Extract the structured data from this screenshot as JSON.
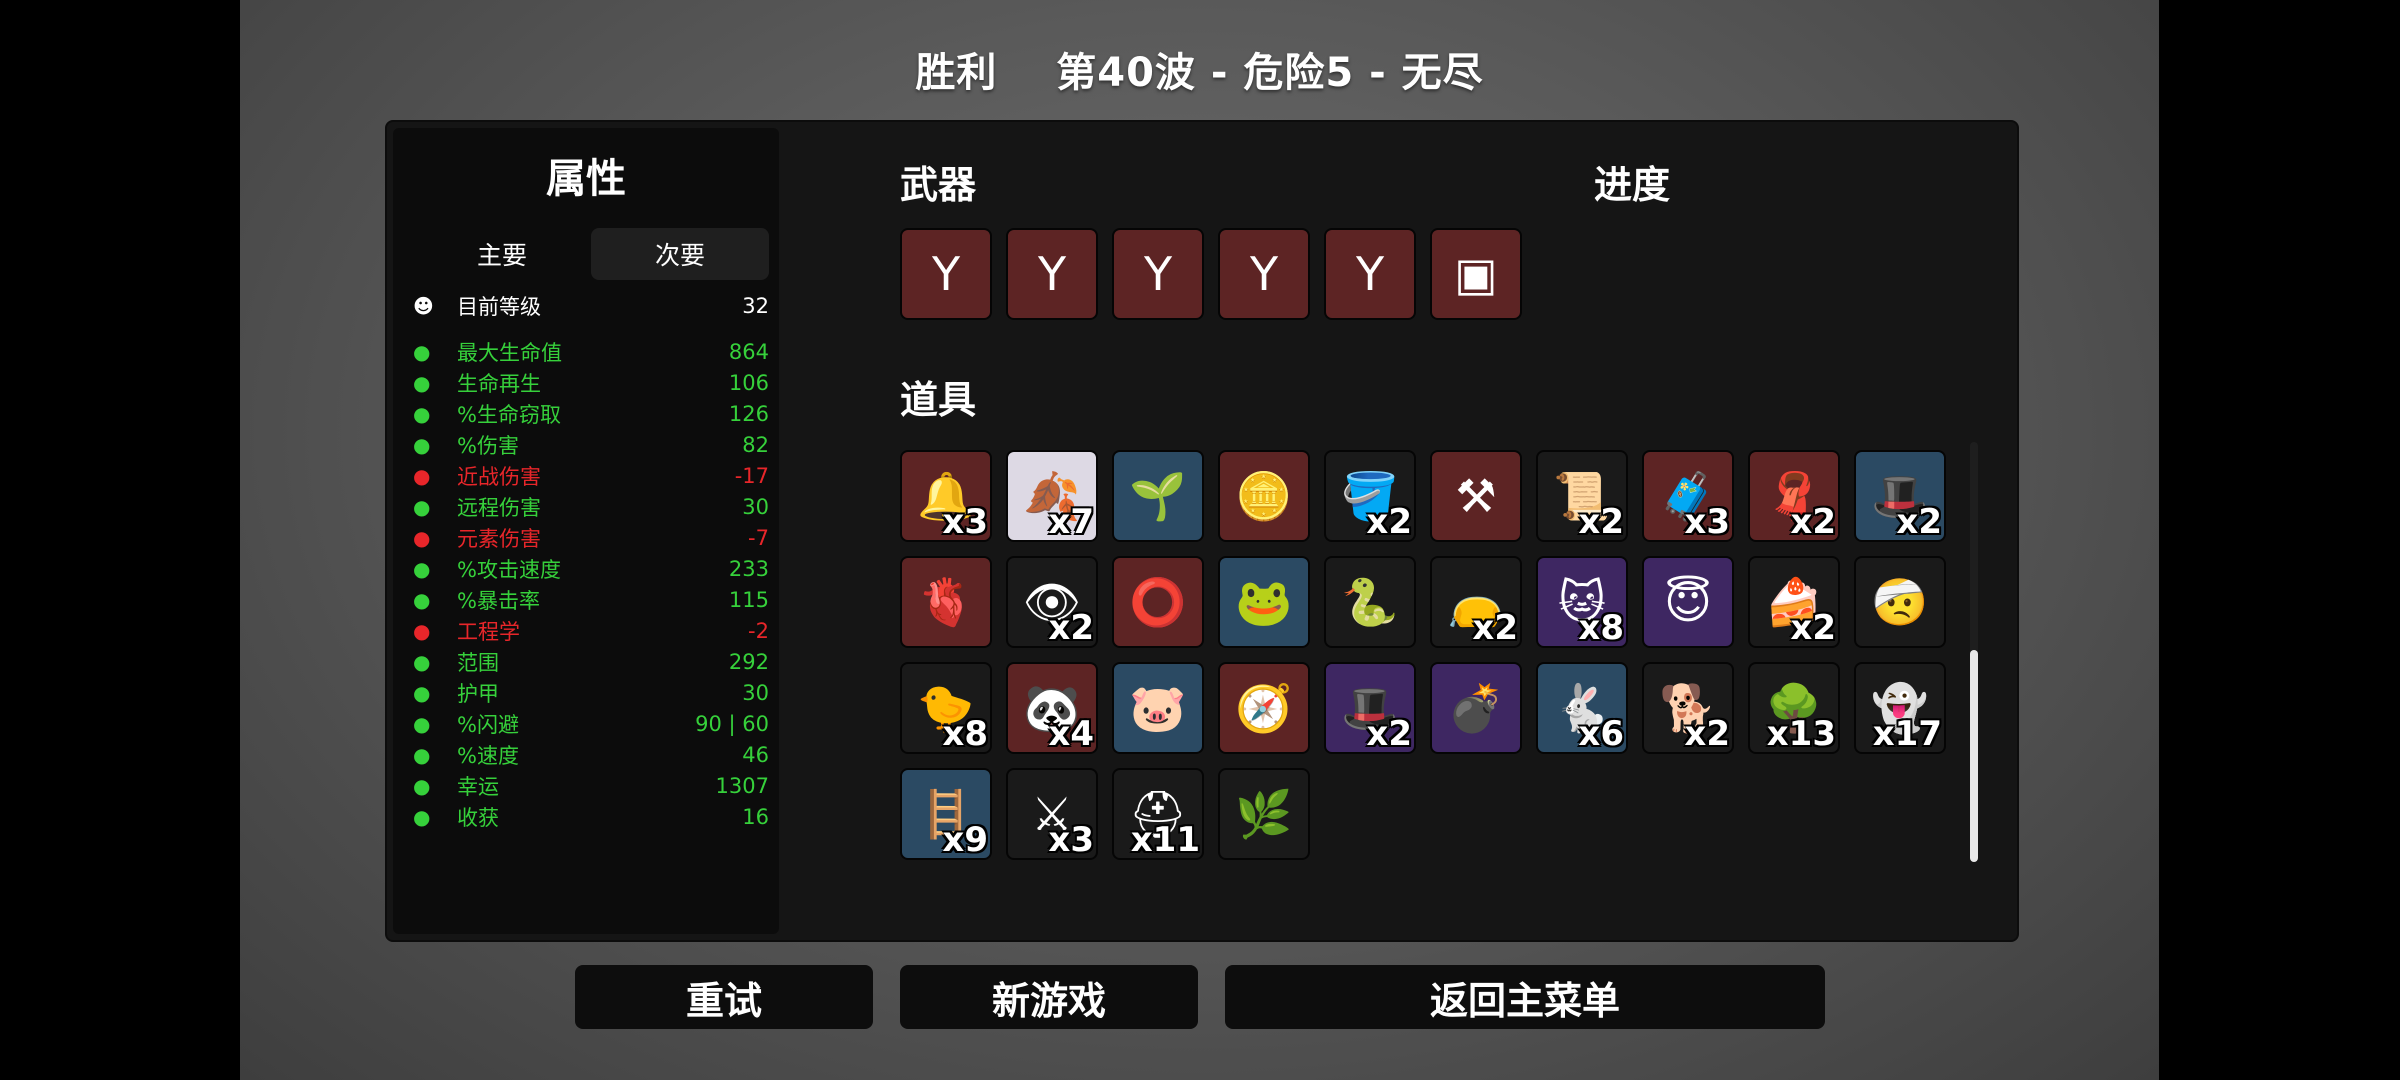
{
  "header": {
    "result": "胜利",
    "wave_info": "第40波 - 危险5 - 无尽"
  },
  "stats_panel": {
    "title": "属性",
    "tabs": [
      "主要",
      "次要"
    ],
    "active_tab": "次要",
    "level": {
      "name": "目前等级",
      "value": "32",
      "icon": "level-icon"
    },
    "items": [
      {
        "name": "最大生命值",
        "value": "864",
        "color": "#36d13b",
        "icon": "heart-icon"
      },
      {
        "name": "生命再生",
        "value": "106",
        "color": "#36d13b",
        "icon": "regen-icon"
      },
      {
        "name": "%生命窃取",
        "value": "126",
        "color": "#36d13b",
        "icon": "lifesteal-icon"
      },
      {
        "name": "%伤害",
        "value": "82",
        "color": "#36d13b",
        "icon": "damage-icon"
      },
      {
        "name": "近战伤害",
        "value": "-17",
        "color": "#e8262a",
        "icon": "melee-icon"
      },
      {
        "name": "远程伤害",
        "value": "30",
        "color": "#36d13b",
        "icon": "ranged-icon"
      },
      {
        "name": "元素伤害",
        "value": "-7",
        "color": "#e8262a",
        "icon": "elemental-icon"
      },
      {
        "name": "%攻击速度",
        "value": "233",
        "color": "#36d13b",
        "icon": "attack-speed-icon"
      },
      {
        "name": "%暴击率",
        "value": "115",
        "color": "#36d13b",
        "icon": "crit-icon"
      },
      {
        "name": "工程学",
        "value": "-2",
        "color": "#e8262a",
        "icon": "engineering-icon"
      },
      {
        "name": "范围",
        "value": "292",
        "color": "#36d13b",
        "icon": "range-icon"
      },
      {
        "name": "护甲",
        "value": "30",
        "color": "#36d13b",
        "icon": "armor-icon"
      },
      {
        "name": "%闪避",
        "value": "90 | 60",
        "color": "#36d13b",
        "icon": "dodge-icon"
      },
      {
        "name": "%速度",
        "value": "46",
        "color": "#36d13b",
        "icon": "speed-icon"
      },
      {
        "name": "幸运",
        "value": "1307",
        "color": "#36d13b",
        "icon": "luck-icon"
      },
      {
        "name": "收获",
        "value": "16",
        "color": "#36d13b",
        "icon": "harvest-icon"
      }
    ]
  },
  "weapons_title": "武器",
  "progress_title": "进度",
  "weapons": [
    {
      "icon": "slingshot-icon",
      "tier": "t4",
      "glyph": "Y"
    },
    {
      "icon": "slingshot-icon",
      "tier": "t4",
      "glyph": "Y"
    },
    {
      "icon": "slingshot-icon",
      "tier": "t4",
      "glyph": "Y"
    },
    {
      "icon": "slingshot-icon",
      "tier": "t4",
      "glyph": "Y"
    },
    {
      "icon": "slingshot-icon",
      "tier": "t4",
      "glyph": "Y"
    },
    {
      "icon": "minigun-icon",
      "tier": "t4",
      "glyph": "▣"
    }
  ],
  "items_title": "道具",
  "items": [
    {
      "icon": "bell-icon",
      "tier": "t4",
      "count": "x3",
      "glyph": "🔔"
    },
    {
      "icon": "rainbow-leaf-icon",
      "tier": "tw",
      "count": "x7",
      "glyph": "🍂"
    },
    {
      "icon": "garden-icon",
      "tier": "t2",
      "count": "",
      "glyph": "🌱"
    },
    {
      "icon": "coin-icon",
      "tier": "t4",
      "count": "",
      "glyph": "🪙"
    },
    {
      "icon": "bucket-icon",
      "tier": "t1",
      "count": "x2",
      "glyph": "🪣"
    },
    {
      "icon": "anvil-icon",
      "tier": "t4",
      "count": "",
      "glyph": "⚒"
    },
    {
      "icon": "scroll-icon",
      "tier": "t1",
      "count": "x2",
      "glyph": "📜"
    },
    {
      "icon": "sleeping-bag-icon",
      "tier": "t4",
      "count": "x3",
      "glyph": "🧳"
    },
    {
      "icon": "cape-icon",
      "tier": "t4",
      "count": "x2",
      "glyph": "🧣"
    },
    {
      "icon": "beret-icon",
      "tier": "t2",
      "count": "x2",
      "glyph": "🎩"
    },
    {
      "icon": "stomach-icon",
      "tier": "t4",
      "count": "",
      "glyph": "🫀"
    },
    {
      "icon": "eyeball-icon",
      "tier": "t1",
      "count": "x2",
      "glyph": "👁"
    },
    {
      "icon": "belt-icon",
      "tier": "t4",
      "count": "",
      "glyph": "⭕"
    },
    {
      "icon": "frog-icon",
      "tier": "t2",
      "count": "",
      "glyph": "🐸"
    },
    {
      "icon": "tentacle-icon",
      "tier": "t1",
      "count": "",
      "glyph": "🐍"
    },
    {
      "icon": "sack-icon",
      "tier": "t1",
      "count": "x2",
      "glyph": "👝"
    },
    {
      "icon": "cat-icon",
      "tier": "t3",
      "count": "x8",
      "glyph": "🐱"
    },
    {
      "icon": "angel-icon",
      "tier": "t3",
      "count": "",
      "glyph": "😇"
    },
    {
      "icon": "cake-icon",
      "tier": "t1",
      "count": "x2",
      "glyph": "🍰"
    },
    {
      "icon": "bandaged-head-icon",
      "tier": "t1",
      "count": "",
      "glyph": "🤕"
    },
    {
      "icon": "duck-icon",
      "tier": "t1",
      "count": "x8",
      "glyph": "🐤"
    },
    {
      "icon": "panda-icon",
      "tier": "t4",
      "count": "x4",
      "glyph": "🐼"
    },
    {
      "icon": "pig-icon",
      "tier": "t2",
      "count": "",
      "glyph": "🐷"
    },
    {
      "icon": "compass-icon",
      "tier": "t4",
      "count": "",
      "glyph": "🧭"
    },
    {
      "icon": "bowler-hat-icon",
      "tier": "t3",
      "count": "x2",
      "glyph": "🎩"
    },
    {
      "icon": "cannon-icon",
      "tier": "t3",
      "count": "",
      "glyph": "💣"
    },
    {
      "icon": "rabbit-icon",
      "tier": "t2",
      "count": "x6",
      "glyph": "🐇"
    },
    {
      "icon": "dog-icon",
      "tier": "t1",
      "count": "x2",
      "glyph": "🐕"
    },
    {
      "icon": "tree-icon",
      "tier": "t1",
      "count": "x13",
      "glyph": "🌳"
    },
    {
      "icon": "ghost-icon",
      "tier": "t1",
      "count": "x17",
      "glyph": "👻"
    },
    {
      "icon": "ladder-icon",
      "tier": "t2",
      "count": "x9",
      "glyph": "🪜"
    },
    {
      "icon": "scythe-icon",
      "tier": "t1",
      "count": "x3",
      "glyph": "⚔"
    },
    {
      "icon": "helmet-icon",
      "tier": "t1",
      "count": "x11",
      "glyph": "⛑"
    },
    {
      "icon": "herb-bag-icon",
      "tier": "t1",
      "count": "",
      "glyph": "🌿"
    }
  ],
  "buttons": {
    "retry": "重试",
    "new_game": "新游戏",
    "main_menu": "返回主菜单"
  }
}
